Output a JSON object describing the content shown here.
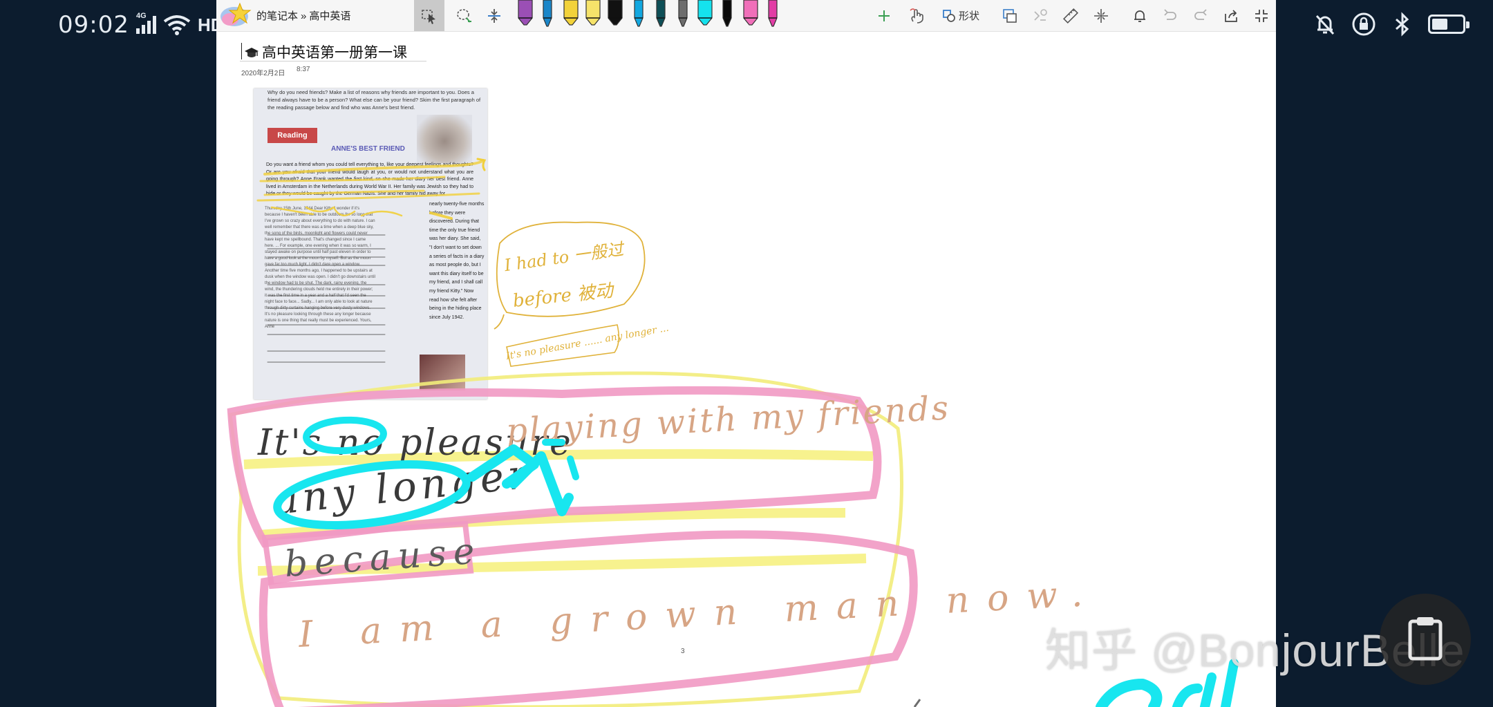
{
  "status_bar": {
    "time": "09:02",
    "network": "4G",
    "hd": "HD"
  },
  "app": {
    "breadcrumb": {
      "notebook": "的笔记本",
      "separator": "»",
      "section": "高中英语"
    },
    "toolbar": {
      "shape_label": "形状",
      "pens": [
        {
          "color": "#9b4fb5",
          "shape": "hl"
        },
        {
          "color": "#1a86c9",
          "shape": "pen"
        },
        {
          "color": "#f2d23a",
          "shape": "hl"
        },
        {
          "color": "#f6e36a",
          "shape": "hl"
        },
        {
          "color": "#111111",
          "shape": "hl"
        },
        {
          "color": "#12a7e0",
          "shape": "pen"
        },
        {
          "color": "#0e4f57",
          "shape": "pen"
        },
        {
          "color": "#6d6d6d",
          "shape": "pen"
        },
        {
          "color": "#15e2ee",
          "shape": "hl"
        },
        {
          "color": "#0a0a0a",
          "shape": "pen"
        },
        {
          "color": "#f06fb9",
          "shape": "hl"
        },
        {
          "color": "#e23da5",
          "shape": "pen"
        }
      ]
    },
    "page": {
      "title": "高中英语第一册第一课",
      "date": "2020年2月2日",
      "time": "8:37",
      "page_number": "3"
    },
    "textbook": {
      "questions": "Why do you need friends? Make a list of reasons why friends are important to you. Does a friend always have to be a person? What else can be your friend? Skim the first paragraph of the reading passage below and find who was Anne's best friend.",
      "banner": "Reading",
      "heading": "ANNE'S BEST FRIEND",
      "body": "Do you want a friend whom you could tell everything to, like your deepest feelings and thoughts? Or are you afraid that your friend would laugh at you, or would not understand what you are going through? Anne Frank wanted the first kind, so she made her diary her best friend. Anne lived in Amsterdam in the Netherlands during World War II. Her family was Jewish so they had to hide or they would be caught by the German Nazis. She and her family hid away for",
      "letter": "Thursday 15th June, 1944 Dear Kitty, I wonder if it's because I haven't been able to be outdoors for so long that I've grown so crazy about everything to do with nature. I can well remember that there was a time when a deep blue sky, the song of the birds, moonlight and flowers could never have kept me spellbound. That's changed since I came here. ... For example, one evening when it was so warm, I stayed awake on purpose until half past eleven in order to have a good look at the moon by myself. But as the moon gave far too much light, I didn't dare open a window. Another time five months ago, I happened to be upstairs at dusk when the window was open. I didn't go downstairs until the window had to be shut. The dark, rainy evening, the wind, the thundering clouds held me entirely in their power; it was the first time in a year and a half that I'd seen the night face to face... Sadly... I am only able to look at nature through dirty curtains hanging before very dusty windows. It's no pleasure looking through these any longer because nature is one thing that really must be experienced. Yours, Anne",
      "right_column": "nearly twenty-five months before they were discovered. During that time the only true friend was her diary. She said, \"I don't want to set down a series of facts in a diary as most people do, but I want this diary itself to be my friend, and I shall call my friend Kitty.\" Now read how she felt after being in the hiding place since July 1942."
    },
    "handwriting": {
      "note_cn_line1": "I had to 一般过",
      "note_cn_line2": "before 被动",
      "note_small": "It's no pleasure ...... any longer ...",
      "line1_black": "It's no pleasure",
      "line1_brown": "playing with my friends",
      "line2": "any longer",
      "line3": "because",
      "line4": "I am a grown man now."
    }
  },
  "watermark": "知乎 @BonjourBelle"
}
